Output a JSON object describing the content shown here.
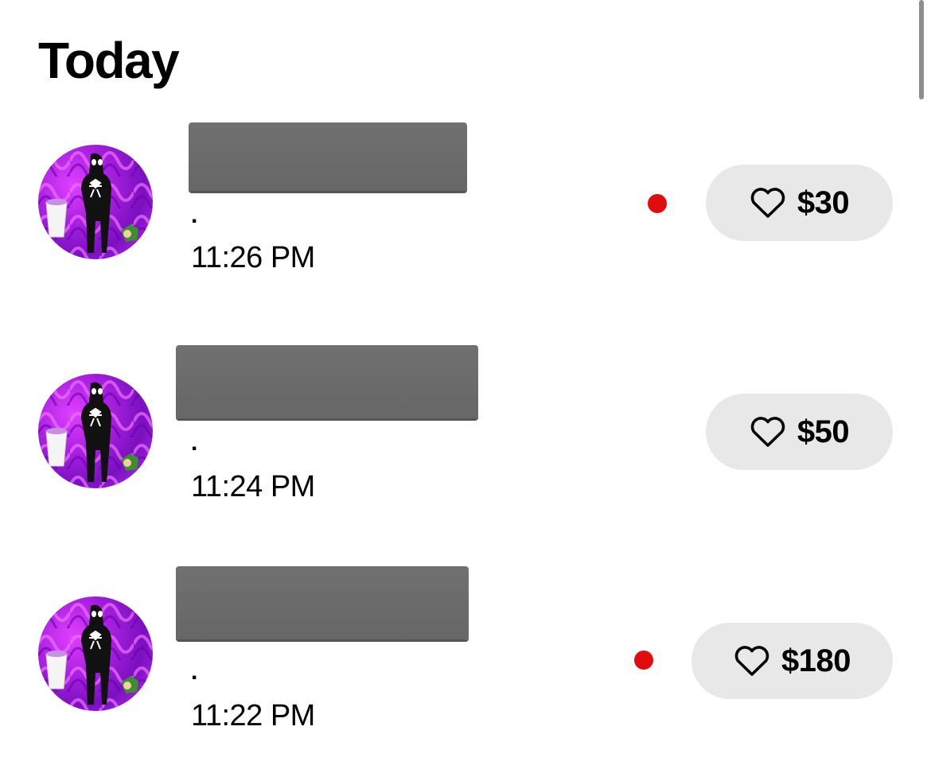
{
  "section": {
    "title": "Today"
  },
  "accent": {
    "unread_dot": "#e00d10",
    "pill_background": "#e8e8e8"
  },
  "items": [
    {
      "preview": ".",
      "time": "11:26 PM",
      "amount": "$30",
      "unread": true,
      "icon": "heart-icon"
    },
    {
      "preview": ".",
      "time": "11:24 PM",
      "amount": "$50",
      "unread": false,
      "icon": "heart-icon"
    },
    {
      "preview": ".",
      "time": "11:22 PM",
      "amount": "$180",
      "unread": true,
      "icon": "heart-icon"
    }
  ]
}
